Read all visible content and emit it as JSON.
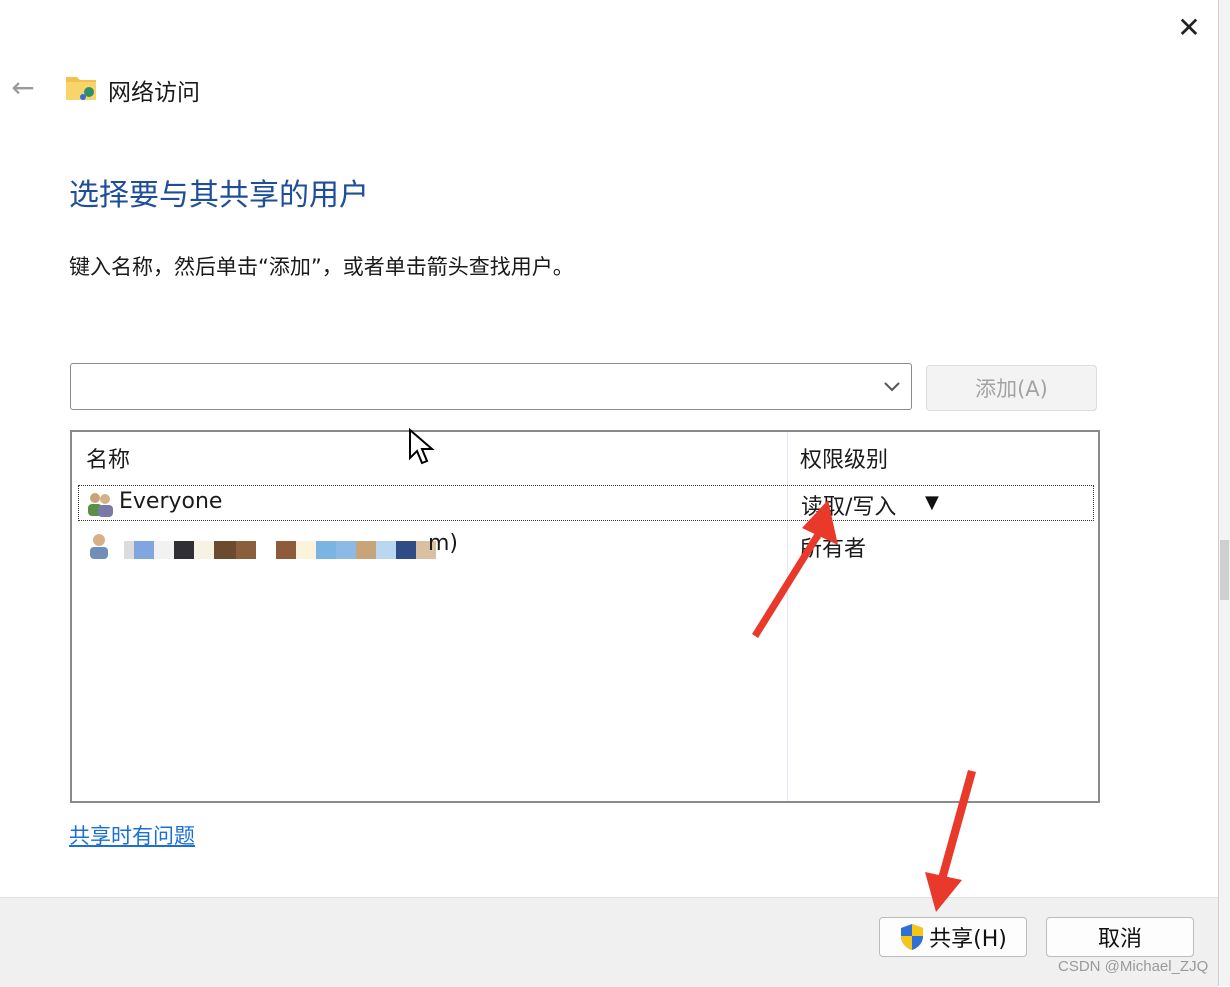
{
  "window": {
    "title": "网络访问",
    "close_glyph": "✕",
    "back_glyph": "←"
  },
  "heading": "选择要与其共享的用户",
  "instruction": "键入名称，然后单击“添加”，或者单击箭头查找用户。",
  "name_input": {
    "value": "",
    "placeholder": ""
  },
  "add_button": "添加(A)",
  "list": {
    "columns": [
      "名称",
      "权限级别"
    ],
    "rows": [
      {
        "name": "Everyone",
        "permission": "读取/写入",
        "icon": "users-group-icon",
        "selected": true
      },
      {
        "name_tail": "m)",
        "permission": "所有者",
        "icon": "user-icon",
        "selected": false
      }
    ]
  },
  "help_link": "共享时有问题",
  "share_button": "共享(H)",
  "cancel_button": "取消",
  "watermark": "CSDN @Michael_ZJQ",
  "colors": {
    "heading_blue": "#1f4e99",
    "link_blue": "#1a6fd6",
    "annotation_red": "#e8392b",
    "shield_blue": "#2f6fd6",
    "shield_yellow": "#f5c518"
  }
}
